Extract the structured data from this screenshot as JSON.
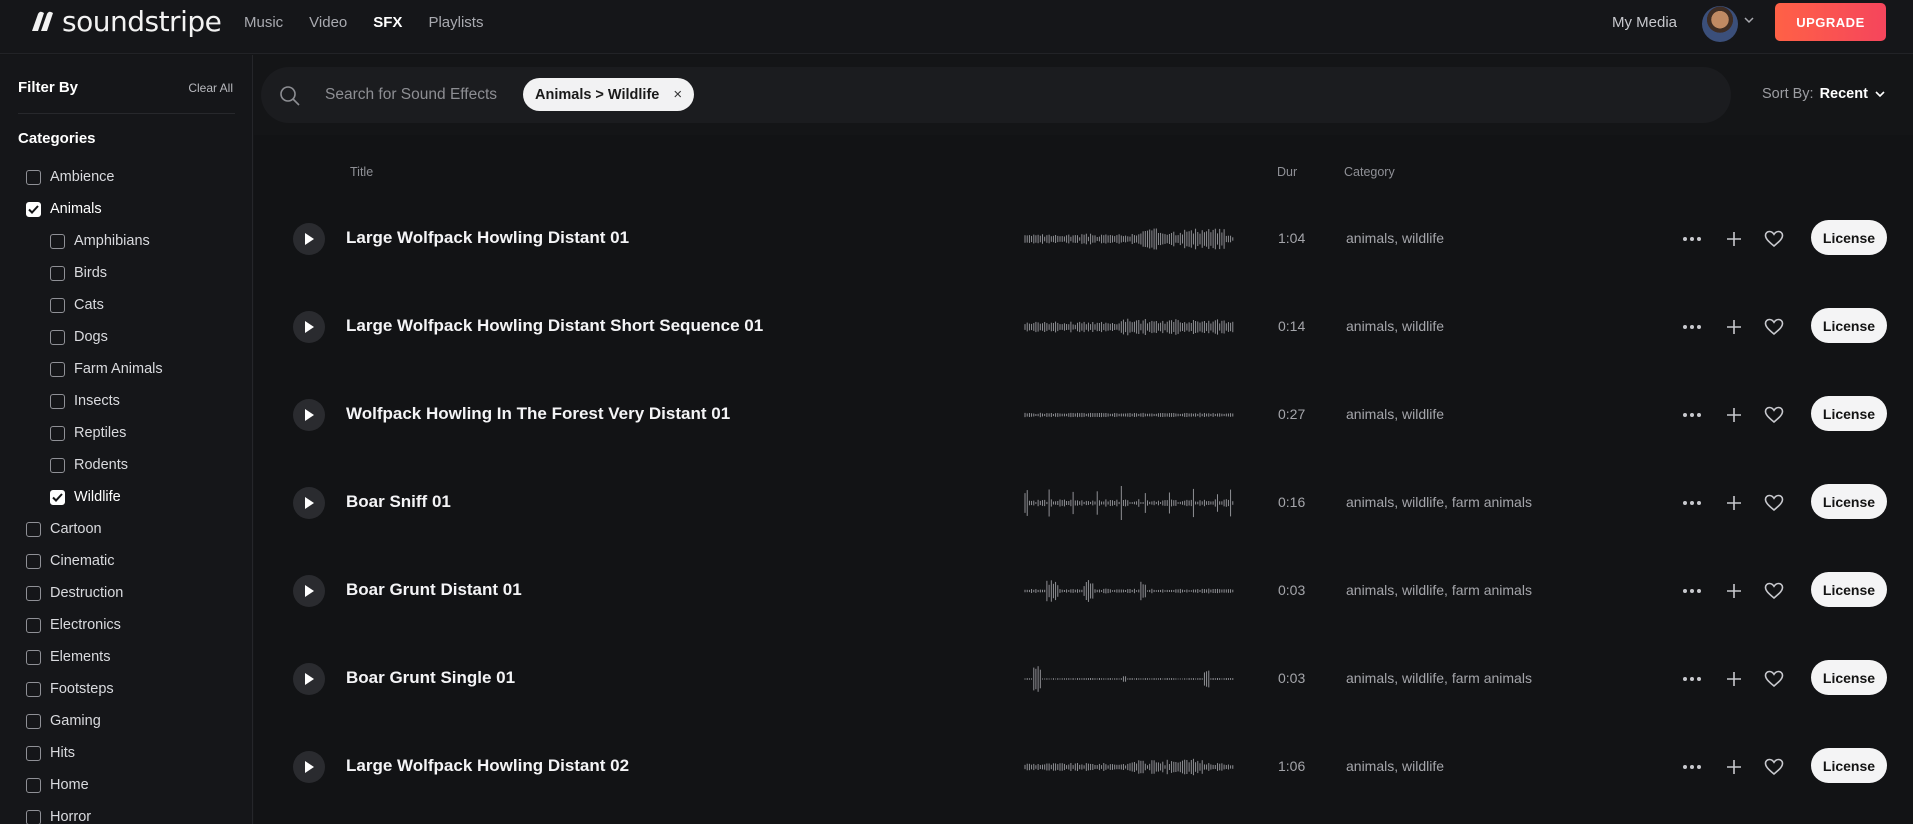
{
  "brand": {
    "name": "soundstripe"
  },
  "nav": [
    {
      "label": "Music",
      "active": false
    },
    {
      "label": "Video",
      "active": false
    },
    {
      "label": "SFX",
      "active": true
    },
    {
      "label": "Playlists",
      "active": false
    }
  ],
  "header": {
    "my_media": "My Media",
    "upgrade": "UPGRADE"
  },
  "sidebar": {
    "title": "Filter By",
    "clear_all": "Clear All",
    "categories_title": "Categories",
    "items": [
      {
        "label": "Ambience",
        "checked": false,
        "level": 0
      },
      {
        "label": "Animals",
        "checked": true,
        "level": 0
      },
      {
        "label": "Amphibians",
        "checked": false,
        "level": 1
      },
      {
        "label": "Birds",
        "checked": false,
        "level": 1
      },
      {
        "label": "Cats",
        "checked": false,
        "level": 1
      },
      {
        "label": "Dogs",
        "checked": false,
        "level": 1
      },
      {
        "label": "Farm Animals",
        "checked": false,
        "level": 1
      },
      {
        "label": "Insects",
        "checked": false,
        "level": 1
      },
      {
        "label": "Reptiles",
        "checked": false,
        "level": 1
      },
      {
        "label": "Rodents",
        "checked": false,
        "level": 1
      },
      {
        "label": "Wildlife",
        "checked": true,
        "level": 1
      },
      {
        "label": "Cartoon",
        "checked": false,
        "level": 0
      },
      {
        "label": "Cinematic",
        "checked": false,
        "level": 0
      },
      {
        "label": "Destruction",
        "checked": false,
        "level": 0
      },
      {
        "label": "Electronics",
        "checked": false,
        "level": 0
      },
      {
        "label": "Elements",
        "checked": false,
        "level": 0
      },
      {
        "label": "Footsteps",
        "checked": false,
        "level": 0
      },
      {
        "label": "Gaming",
        "checked": false,
        "level": 0
      },
      {
        "label": "Hits",
        "checked": false,
        "level": 0
      },
      {
        "label": "Home",
        "checked": false,
        "level": 0
      },
      {
        "label": "Horror",
        "checked": false,
        "level": 0
      }
    ]
  },
  "search": {
    "placeholder": "Search for Sound Effects",
    "value": "",
    "chip": "Animals > Wildlife",
    "chip_close": "×"
  },
  "sort": {
    "label": "Sort By:",
    "value": "Recent"
  },
  "table": {
    "headers": {
      "title": "Title",
      "dur": "Dur",
      "category": "Category"
    },
    "license_label": "License",
    "rows": [
      {
        "title": "Large Wolfpack Howling Distant 01",
        "dur": "1:04",
        "category": "animals, wildlife",
        "wave": "howl"
      },
      {
        "title": "Large Wolfpack Howling Distant Short Sequence 01",
        "dur": "0:14",
        "category": "animals, wildlife",
        "wave": "dense"
      },
      {
        "title": "Wolfpack Howling In The Forest Very Distant 01",
        "dur": "0:27",
        "category": "animals, wildlife",
        "wave": "flat"
      },
      {
        "title": "Boar Sniff 01",
        "dur": "0:16",
        "category": "animals, wildlife, farm animals",
        "wave": "sniff"
      },
      {
        "title": "Boar Grunt Distant 01",
        "dur": "0:03",
        "category": "animals, wildlife, farm animals",
        "wave": "grunt"
      },
      {
        "title": "Boar Grunt Single 01",
        "dur": "0:03",
        "category": "animals, wildlife, farm animals",
        "wave": "single"
      },
      {
        "title": "Large Wolfpack Howling Distant 02",
        "dur": "1:06",
        "category": "animals, wildlife",
        "wave": "howl2"
      }
    ]
  },
  "icons": {
    "play": "play-icon",
    "more": "more-dots-icon",
    "add": "plus-icon",
    "favorite": "heart-icon",
    "search": "search-icon",
    "caret": "chevron-down-icon"
  },
  "colors": {
    "accent_start": "#ff6146",
    "accent_end": "#f5455c",
    "background": "#141517"
  }
}
